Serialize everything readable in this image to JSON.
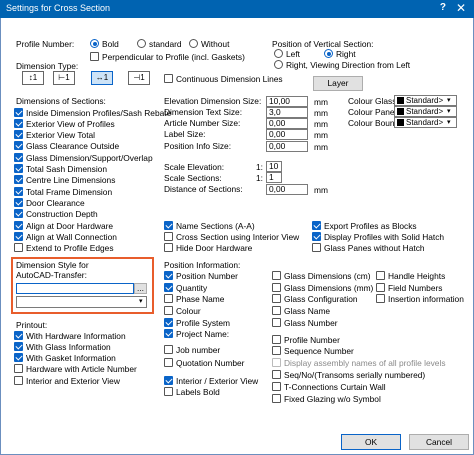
{
  "window": {
    "title": "Settings for Cross Section",
    "help": "?",
    "close": "✕"
  },
  "profile_number": {
    "label": "Profile Number:",
    "options": [
      "Bold",
      "standard",
      "Without"
    ],
    "perpendicular": "Perpendicular to Profile (incl. Gaskets)"
  },
  "vertical_position": {
    "label": "Position of Vertical Section:",
    "options": [
      "Left",
      "Right",
      "Right, Viewing Direction from Left"
    ]
  },
  "dimension_type": {
    "label": "Dimension Type:",
    "buttons": [
      "↕1",
      "⊢1",
      "↔1",
      "⊣1"
    ],
    "continuous": "Continuous Dimension Lines",
    "layer_button": "Layer"
  },
  "dimensions_of_sections": {
    "label": "Dimensions of Sections:",
    "items": [
      "Inside Dimension Profiles/Sash Rebate",
      "Exterior View of Profiles",
      "Exterior View Total",
      "Glass Clearance Outside",
      "Glass Dimension/Support/Overlap",
      "Total Sash Dimension",
      "Centre Line Dimensions",
      "Total Frame Dimension",
      "Door Clearance",
      "Construction Depth",
      "Align at Door Hardware",
      "Align at Wall Connection",
      "Extend to Profile Edges"
    ]
  },
  "sizes": {
    "elevation_label": "Elevation Dimension Size:",
    "elevation_value": "10,00",
    "unit1": "mm",
    "text_label": "Dimension Text Size:",
    "text_value": "3,0",
    "unit2": "mm",
    "article_label": "Article Number Size:",
    "article_value": "0,00",
    "unit3": "mm",
    "label_label": "Label Size:",
    "label_value": "0,00",
    "unit4": "mm",
    "posinfo_label": "Position Info Size:",
    "posinfo_value": "0,00",
    "unit5": "mm"
  },
  "colours": {
    "glass_label": "Colour Glass:",
    "glass_value": "Standard>",
    "panel_label": "Colour Panel:",
    "panel_value": "Standard>",
    "boundary_label": "Colour Boundary:",
    "boundary_value": "Standard>"
  },
  "scale": {
    "elevation_label": "Scale Elevation:",
    "elevation_prefix": "1:",
    "elevation_value": "10",
    "sections_label": "Scale Sections:",
    "sections_prefix": "1:",
    "sections_value": "1",
    "distance_label": "Distance of Sections:",
    "distance_value": "0,00",
    "distance_unit": "mm"
  },
  "middle_options": [
    "Name Sections (A-A)",
    "Cross Section using Interior View",
    "Hide Door Hardware"
  ],
  "export_options": [
    "Export Profiles as Blocks",
    "Display Profiles with Solid Hatch",
    "Glass Panes without Hatch"
  ],
  "dimension_style": {
    "label_line1": "Dimension Style for",
    "label_line2": "AutoCAD-Transfer:",
    "value": "",
    "browse": "..."
  },
  "printout": {
    "label": "Printout:",
    "items": [
      "With Hardware Information",
      "With Glass Information",
      "With Gasket Information",
      "Hardware with Article Number",
      "Interior and Exterior View"
    ]
  },
  "position_information": {
    "label": "Position Information:",
    "col1": [
      "Position Number",
      "Quantity",
      "Phase Name",
      "Colour",
      "Profile System",
      "Project Name:",
      "Job number",
      "Quotation Number",
      "Interior / Exterior View",
      "Labels Bold"
    ],
    "col2": [
      "Glass Dimensions (cm)",
      "Glass Dimensions (mm)",
      "Glass Configuration",
      "Glass Name",
      "Glass Number"
    ],
    "col3": [
      "Handle Heights",
      "Field Numbers",
      "Insertion information"
    ],
    "col2b": [
      "Profile Number",
      "Sequence Number",
      "Display assembly names of all profile levels",
      "Seq/No/(Transoms serially numbered)",
      "T-Connections Curtain Wall",
      "Fixed Glazing w/o Symbol"
    ]
  },
  "footer": {
    "ok": "OK",
    "cancel": "Cancel"
  }
}
